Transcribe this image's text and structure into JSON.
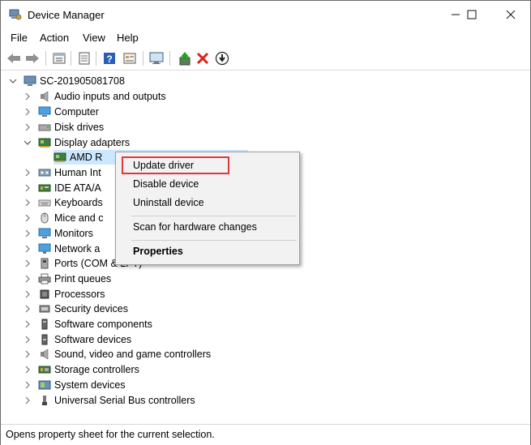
{
  "window": {
    "title": "Device Manager",
    "minimize_icon": "minimize-icon",
    "maximize_icon": "maximize-icon",
    "close_icon": "close-icon"
  },
  "menubar": {
    "items": [
      "File",
      "Action",
      "View",
      "Help"
    ]
  },
  "toolbar": {
    "icons": [
      "back-arrow-icon",
      "forward-arrow-icon",
      "device-view-icon",
      "properties-icon",
      "help-icon",
      "details-icon",
      "monitor-icon",
      "update-driver-icon",
      "uninstall-x-icon",
      "download-icon"
    ]
  },
  "tree": {
    "root": "SC-201905081708",
    "categories": [
      {
        "label": "Audio inputs and outputs",
        "icon": "speaker-icon"
      },
      {
        "label": "Computer",
        "icon": "computer-icon"
      },
      {
        "label": "Disk drives",
        "icon": "disk-drive-icon"
      },
      {
        "label": "Display adapters",
        "icon": "display-adapter-icon",
        "expanded": true
      },
      {
        "label": "Human Int",
        "icon": "hid-icon"
      },
      {
        "label": "IDE ATA/A",
        "icon": "ide-icon"
      },
      {
        "label": "Keyboards",
        "icon": "keyboard-icon"
      },
      {
        "label": "Mice and c",
        "icon": "mouse-icon"
      },
      {
        "label": "Monitors",
        "icon": "monitor-icon"
      },
      {
        "label": "Network a",
        "icon": "network-icon"
      },
      {
        "label": "Ports (COM & LPT)",
        "icon": "port-icon"
      },
      {
        "label": "Print queues",
        "icon": "printer-icon"
      },
      {
        "label": "Processors",
        "icon": "processor-icon"
      },
      {
        "label": "Security devices",
        "icon": "security-icon"
      },
      {
        "label": "Software components",
        "icon": "software-component-icon"
      },
      {
        "label": "Software devices",
        "icon": "software-device-icon"
      },
      {
        "label": "Sound, video and game controllers",
        "icon": "sound-icon"
      },
      {
        "label": "Storage controllers",
        "icon": "storage-icon"
      },
      {
        "label": "System devices",
        "icon": "system-icon"
      },
      {
        "label": "Universal Serial Bus controllers",
        "icon": "usb-icon"
      }
    ],
    "child_device": "AMD R"
  },
  "context_menu": {
    "update_driver": "Update driver",
    "disable_device": "Disable device",
    "uninstall_device": "Uninstall device",
    "scan_hardware": "Scan for hardware changes",
    "properties": "Properties",
    "highlight_color": "#e0363c"
  },
  "statusbar": {
    "text": "Opens property sheet for the current selection."
  },
  "colors": {
    "selection": "#cce8ff",
    "menu_bg": "#f2f2f2"
  }
}
